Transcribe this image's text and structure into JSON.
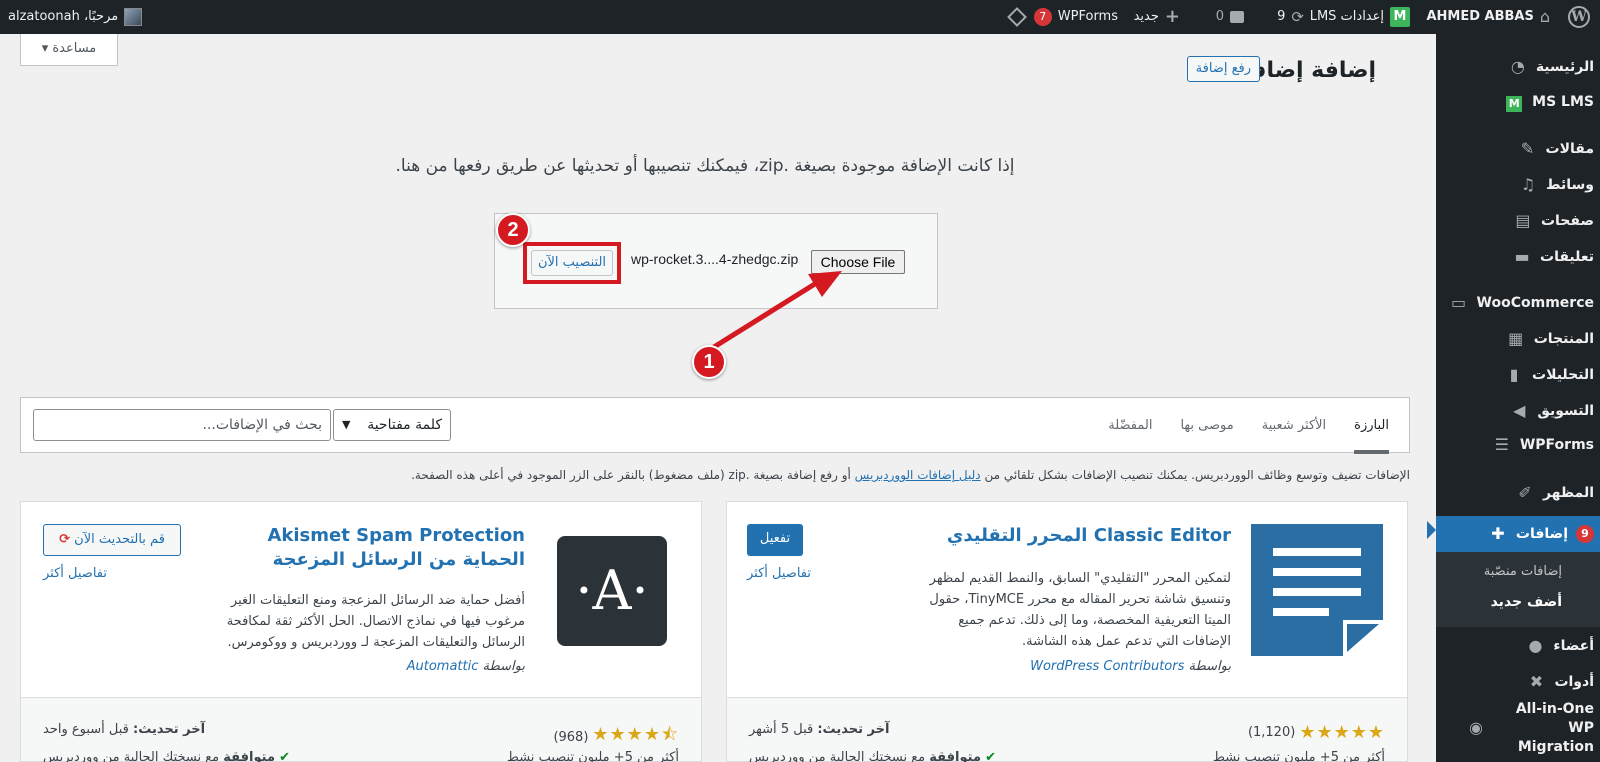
{
  "admin_bar": {
    "site_name": "AHMED ABBAS",
    "lms_settings": "إعدادات LMS",
    "updates_count": "9",
    "comments_count": "0",
    "new_label": "جديد",
    "wpforms_label": "WPForms",
    "wpforms_badge": "7",
    "greeting": "مرحبًا، alzatoonah"
  },
  "sidebar": {
    "items": [
      {
        "label": "الرئيسية",
        "icon": "gauge-icon"
      },
      {
        "label": "MS LMS",
        "icon": "ms-lms-icon"
      },
      {
        "label": "مقالات",
        "icon": "pin-icon"
      },
      {
        "label": "وسائط",
        "icon": "media-icon"
      },
      {
        "label": "صفحات",
        "icon": "pages-icon"
      },
      {
        "label": "تعليقات",
        "icon": "comment-icon"
      },
      {
        "label": "WooCommerce",
        "icon": "woo-icon"
      },
      {
        "label": "المنتجات",
        "icon": "products-icon"
      },
      {
        "label": "التحليلات",
        "icon": "analytics-icon"
      },
      {
        "label": "التسويق",
        "icon": "megaphone-icon"
      },
      {
        "label": "WPForms",
        "icon": "wpforms-icon"
      },
      {
        "label": "المظهر",
        "icon": "brush-icon"
      },
      {
        "label": "إضافات",
        "icon": "plugin-icon",
        "badge": "9"
      },
      {
        "label": "أعضاء",
        "icon": "users-icon"
      },
      {
        "label": "أدوات",
        "icon": "tools-icon"
      },
      {
        "label": "All-in-One WP Migration",
        "icon": "migration-icon"
      }
    ],
    "submenu": {
      "installed": "إضافات منصّبة",
      "add_new": "أضف جديد"
    }
  },
  "main": {
    "help_tab": "مساعدة ▾",
    "page_title": "إضافة إضافات",
    "upload_button": "رفع إضافة",
    "upload_hint": "إذا كانت الإضافة موجودة بصيغة .zip، فيمكنك تنصيبها أو تحديثها عن طريق رفعها من هنا.",
    "choose_file": "Choose File",
    "file_name": "wp-rocket.3....4-zhedgc.zip",
    "install_now": "التنصيب الآن",
    "step1": "1",
    "step2": "2"
  },
  "filter": {
    "tabs": [
      "البارزة",
      "الأكثر شعبية",
      "موصى بها",
      "المفضّلة"
    ],
    "active_tab": "البارزة",
    "search_type": "كلمة مفتاحية",
    "search_placeholder": "بحث في الإضافات..."
  },
  "info": {
    "before": "الإضافات تضيف وتوسع وظائف الووردبريس. يمكنك تنصيب الإضافات بشكل تلقائي من",
    "link": "دليل إضافات الووردبريس",
    "after": "أو رفع إضافة بصيغة .zip (ملف مضغوط) بالنقر على الزر الموجود في أعلى هذه الصفحة."
  },
  "cards": [
    {
      "name": "Classic Editor المحرر التقليدي",
      "desc": "لتمكين المحرر \"التقليدي\" السابق، والنمط القديم لمظهر وتنسيق شاشة تحرير المقاله مع محرر TinyMCE، حقول الميتا التعريفية المخصصة، وما إلى ذلك. تدعم جميع الإضافات التي تدعم عمل هذه الشاشة.",
      "author_prefix": "بواسطة",
      "author": "WordPress Contributors",
      "action": "تفعيل",
      "details": "تفاصيل أكثر",
      "rating_count": "(1,120)",
      "updated_label": "آخر تحديث:",
      "updated_value": "قبل 5 أشهر",
      "installs": "أكثر من 5+ مليون تنصيب نشط",
      "compat_label": "متوافقة",
      "compat_rest": "مع نسختك الحالية من ووردبريس"
    },
    {
      "name": "Akismet Spam Protection الحماية من الرسائل المزعجة",
      "desc": "أفضل حماية ضد الرسائل المزعجة ومنع التعليقات الغير مرغوب فيها في نماذج الاتصال. الحل الأكثر ثقة لمكافحة الرسائل والتعليقات المزعجة لـ ووردبريس و ووكومرس.",
      "author_prefix": "بواسطة",
      "author": "Automattic",
      "action": "قم بالتحديث الآن",
      "details": "تفاصيل أكثر",
      "rating_count": "(968)",
      "updated_label": "آخر تحديث:",
      "updated_value": "قبل أسبوع واحد",
      "installs": "أكثر من 5+ مليون تنصيب نشط",
      "compat_label": "متوافقة",
      "compat_rest": "مع نسختك الحالية من ووردبريس"
    }
  ],
  "colors": {
    "accent": "#2271b1",
    "admin_bg": "#1d2327",
    "annotation_red": "#d41920",
    "star": "#dba617"
  }
}
